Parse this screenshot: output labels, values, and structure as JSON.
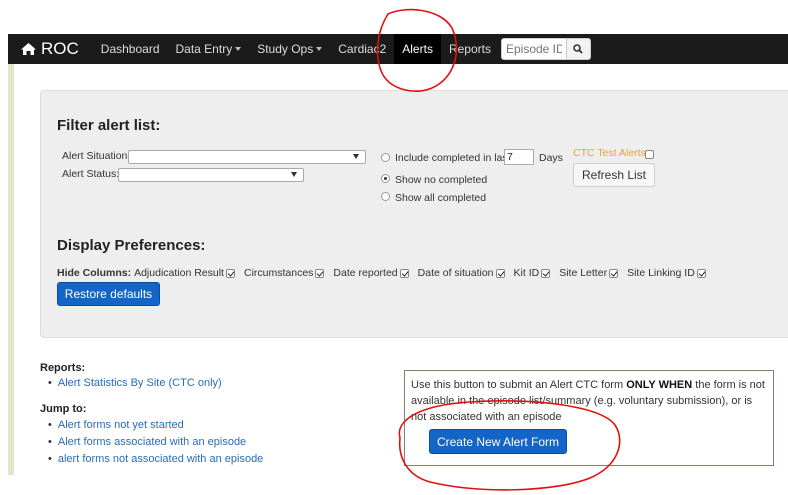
{
  "nav": {
    "brand": "ROC",
    "items": [
      {
        "label": "Dashboard"
      },
      {
        "label": "Data Entry"
      },
      {
        "label": "Study Ops"
      },
      {
        "label": "Cardiac2"
      },
      {
        "label": "Alerts"
      },
      {
        "label": "Reports"
      }
    ],
    "search_placeholder": "Episode ID"
  },
  "filter": {
    "title": "Filter alert list:",
    "situation_label": "Alert Situation:",
    "status_label": "Alert Status:",
    "include_completed_label": "Include completed in last",
    "days_value": "7",
    "days_label": "Days",
    "show_no_completed_label": "Show no completed",
    "show_all_completed_label": "Show all completed",
    "ctc_test_label": "CTC Test Alerts:",
    "refresh_label": "Refresh List"
  },
  "display": {
    "title": "Display Preferences:",
    "hide_columns_label": "Hide Columns:",
    "columns": [
      {
        "label": "Adjudication Result",
        "checked": true
      },
      {
        "label": "Circumstances",
        "checked": true
      },
      {
        "label": "Date reported",
        "checked": true
      },
      {
        "label": "Date of situation",
        "checked": true
      },
      {
        "label": "Kit ID",
        "checked": true
      },
      {
        "label": "Site Letter",
        "checked": true
      },
      {
        "label": "Site Linking ID",
        "checked": true
      }
    ],
    "restore_label": "Restore defaults"
  },
  "reports": {
    "heading": "Reports:",
    "links": [
      "Alert Statistics By Site (CTC only)"
    ]
  },
  "jump": {
    "heading": "Jump to:",
    "links": [
      "Alert forms not yet started",
      "Alert forms associated with an episode",
      "alert forms not associated with an episode"
    ]
  },
  "note": {
    "prefix": "Use this button to submit an Alert CTC form ",
    "emphasis": "ONLY WHEN",
    "suffix": " the form is not available in the episode list/summary (e.g. voluntary submission), or is not associated with an episode",
    "button_label": "Create New Alert Form"
  },
  "colors": {
    "navbar": "#1b1b1b",
    "primary_button": "#1366c7",
    "link": "#2a6db5",
    "ctc_label": "#e8a040",
    "annotation": "#e01010"
  }
}
